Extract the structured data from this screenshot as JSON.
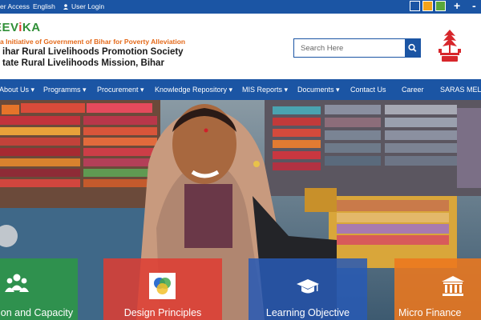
{
  "topbar": {
    "links": [
      "er Access",
      "English",
      "User Login"
    ],
    "theme_colors": [
      "#1b55a4",
      "#f2a31b",
      "#5aa83a"
    ],
    "zoom_in": "+",
    "zoom_out": "-"
  },
  "header": {
    "logo_prefix": "EEV",
    "logo_i": "i",
    "logo_suffix": "KA",
    "tagline": "a Initiative of Government of Bihar for Poverty Alleviation",
    "org_line1": "ihar Rural Livelihoods Promotion Society",
    "org_line2": "tate Rural Livelihoods Mission, Bihar",
    "search_placeholder": "Search Here",
    "emblem_icon": "bihar-emblem-icon"
  },
  "nav": {
    "items": [
      "About Us ▾",
      "Programms ▾",
      "Procurement ▾",
      "Knowledge Repository ▾",
      "MIS Reports ▾",
      "Documents ▾",
      "Contact Us",
      "Career",
      "SARAS MELA"
    ]
  },
  "tiles": [
    {
      "label": "ion and Capacity",
      "icon": "people-group-icon",
      "color": "#2e9646"
    },
    {
      "label": "Design Principles",
      "icon": "circles-icon",
      "color": "#de3c32"
    },
    {
      "label": "Learning Objective",
      "icon": "graduation-cap-icon",
      "color": "#285ab4"
    },
    {
      "label": "Micro Finance",
      "icon": "bank-icon",
      "color": "#ec781e"
    }
  ]
}
